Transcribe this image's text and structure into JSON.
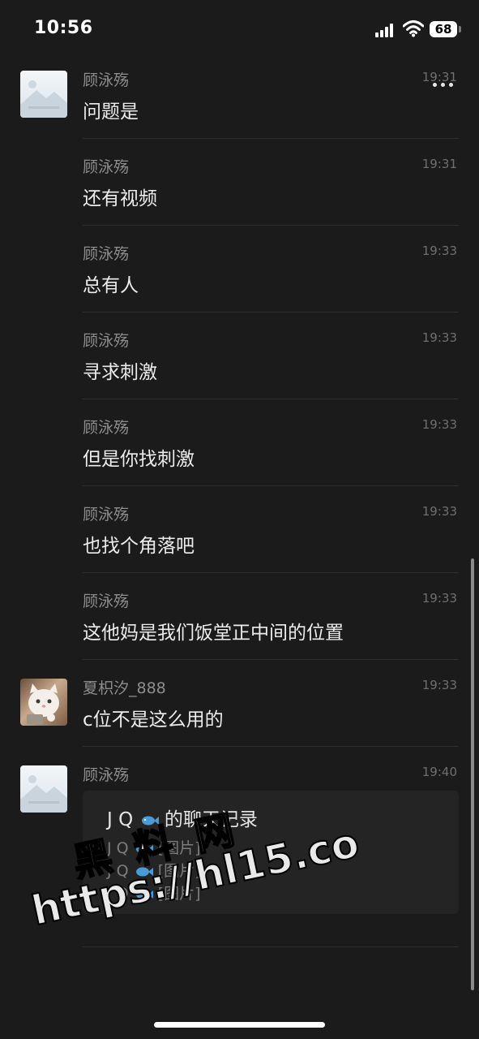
{
  "status_bar": {
    "time": "10:56",
    "battery": "68"
  },
  "messages": [
    {
      "sender": "顾泳殇",
      "time": "19:31",
      "text": "问题是",
      "avatar": "landscape-placeholder"
    },
    {
      "sender": "顾泳殇",
      "time": "19:31",
      "text": "还有视频"
    },
    {
      "sender": "顾泳殇",
      "time": "19:33",
      "text": "总有人"
    },
    {
      "sender": "顾泳殇",
      "time": "19:33",
      "text": "寻求刺激"
    },
    {
      "sender": "顾泳殇",
      "time": "19:33",
      "text": "但是你找刺激"
    },
    {
      "sender": "顾泳殇",
      "time": "19:33",
      "text": "也找个角落吧"
    },
    {
      "sender": "顾泳殇",
      "time": "19:33",
      "text": "这他妈是我们饭堂正中间的位置"
    },
    {
      "sender": "夏枳汐_888",
      "time": "19:33",
      "text": "c位不是这么用的",
      "avatar": "cat-photo"
    },
    {
      "sender": "顾泳殇",
      "time": "19:40",
      "avatar": "landscape-placeholder"
    }
  ],
  "chat_record_card": {
    "title_prefix": "J Q",
    "title_suffix": "的聊天记录",
    "lines": [
      {
        "name": "J Q",
        "content": "[图片]"
      },
      {
        "name": "J Q",
        "content": "[图片]"
      },
      {
        "name": "J Q",
        "content": "[图片]"
      }
    ]
  },
  "watermark": {
    "line1": "黑 料 网",
    "line2": "https://hl15.co"
  },
  "icons": {
    "more": "more-dots-icon",
    "signal": "cellular-signal-icon",
    "wifi": "wifi-icon",
    "battery": "battery-icon",
    "emoji": "fish-emoji-icon"
  }
}
